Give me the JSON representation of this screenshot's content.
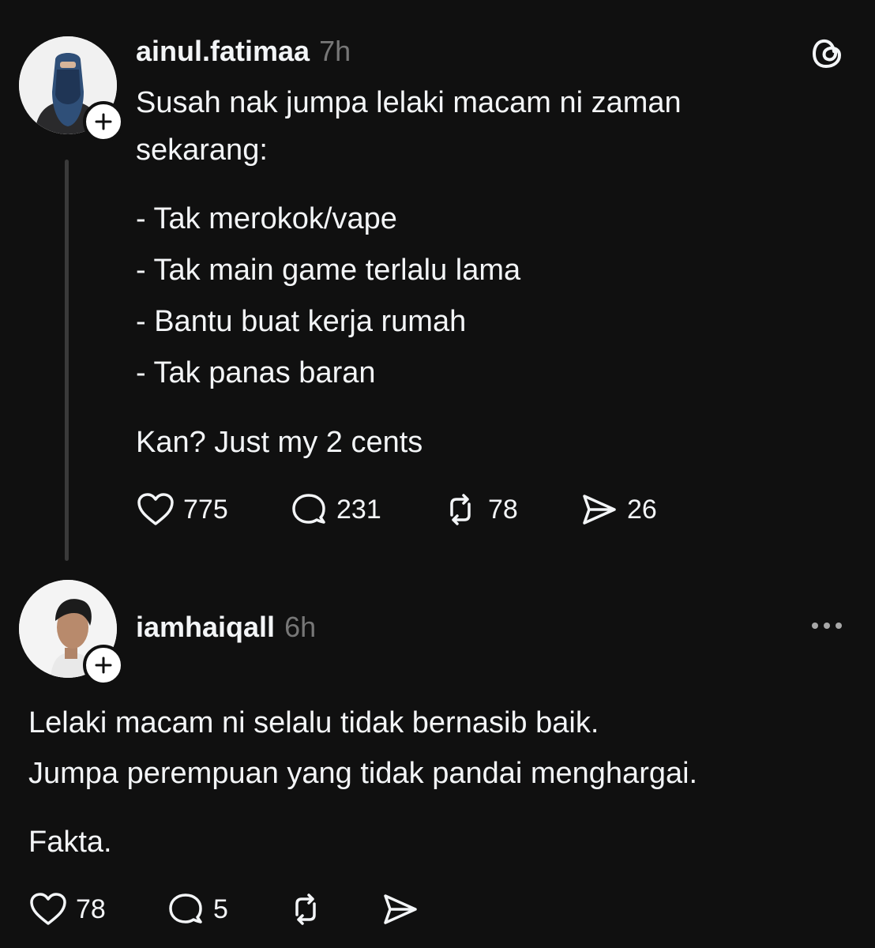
{
  "colors": {
    "background": "#101010",
    "text": "#f3f5f7",
    "muted": "#777777"
  },
  "post": {
    "username": "ainul.fatimaa",
    "time": "7h",
    "lines": [
      "Susah nak jumpa lelaki macam ni zaman",
      "sekarang:"
    ],
    "list": [
      "- Tak merokok/vape",
      "- Tak main game terlalu lama",
      "- Bantu buat kerja rumah",
      "- Tak panas baran"
    ],
    "closing": "Kan? Just my 2 cents",
    "stats": {
      "likes": "775",
      "replies": "231",
      "reposts": "78",
      "shares": "26"
    },
    "icons": {
      "logo": "threads-logo-icon",
      "follow": "plus-icon"
    }
  },
  "reply": {
    "username": "iamhaiqall",
    "time": "6h",
    "lines": [
      "Lelaki macam ni selalu tidak bernasib baik.",
      "Jumpa perempuan yang tidak pandai menghargai."
    ],
    "closing": "Fakta.",
    "stats": {
      "likes": "78",
      "replies": "5"
    },
    "icons": {
      "menu": "more-icon",
      "follow": "plus-icon"
    }
  }
}
